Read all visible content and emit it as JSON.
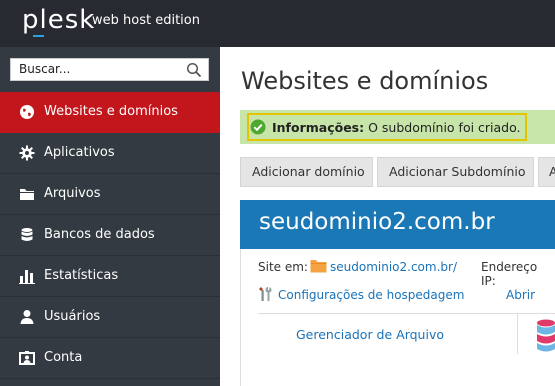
{
  "header": {
    "logo": "plesk",
    "edition": "web host edition"
  },
  "sidebar": {
    "search_placeholder": "Buscar...",
    "items": [
      {
        "label": "Websites e domínios",
        "icon": "globe-icon",
        "active": true
      },
      {
        "label": "Aplicativos",
        "icon": "gear-icon"
      },
      {
        "label": "Arquivos",
        "icon": "folder-icon"
      },
      {
        "label": "Bancos de dados",
        "icon": "database-icon"
      },
      {
        "label": "Estatísticas",
        "icon": "bar-chart-icon"
      },
      {
        "label": "Usuários",
        "icon": "user-icon"
      },
      {
        "label": "Conta",
        "icon": "account-icon"
      }
    ]
  },
  "main": {
    "title": "Websites e domínios",
    "message": {
      "label": "Informações:",
      "text": "O subdomínio foi criado."
    },
    "buttons": [
      "Adicionar domínio",
      "Adicionar Subdomínio",
      "Ad"
    ],
    "domain": {
      "name": "seudominio2.com.br",
      "site_label": "Site em:",
      "site_link": "seudominio2.com.br/",
      "ip_label": "Endereço IP:",
      "hosting_link": "Configurações de hospedagem",
      "open_link": "Abrir",
      "file_manager": "Gerenciador de Arquivo"
    }
  },
  "colors": {
    "topbar": "#272b31",
    "sidebar": "#333a41",
    "active": "#c2161c",
    "domain_header": "#1b78b6",
    "success_bg": "#c7e5a8",
    "highlight": "#e3c400",
    "link": "#1a73b9"
  }
}
